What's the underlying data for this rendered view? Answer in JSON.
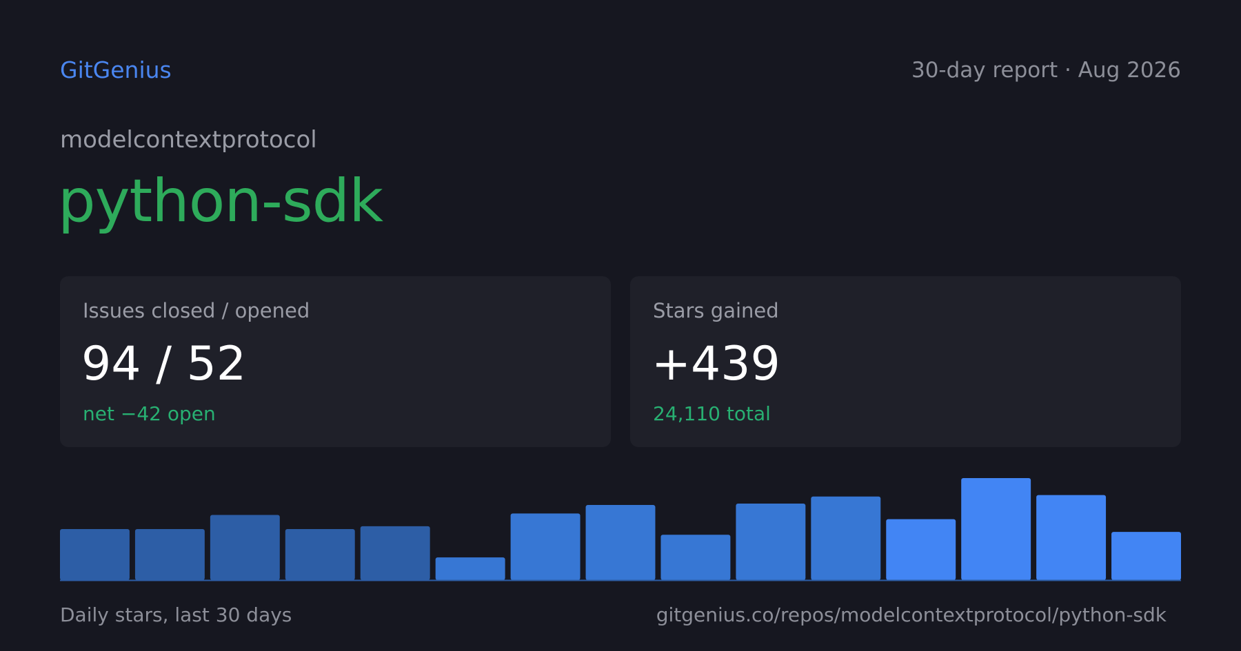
{
  "header": {
    "brand": "GitGenius",
    "report_meta": "30-day report · Aug 2026"
  },
  "repo": {
    "owner": "modelcontextprotocol",
    "name": "python-sdk"
  },
  "cards": {
    "issues": {
      "label": "Issues closed / opened",
      "value": "94 / 52",
      "sub": "net −42 open"
    },
    "stars": {
      "label": "Stars gained",
      "value": "+439",
      "sub": "24,110  total"
    }
  },
  "footer": {
    "caption": "Daily stars, last 30 days",
    "url": "gitgenius.co/repos/modelcontextprotocol/python-sdk"
  },
  "colors": {
    "background": "#161720",
    "card": "#1f2029",
    "brand": "#4a86f0",
    "repo_name": "#2eab5b",
    "positive": "#28b072",
    "bar_dark": "#2d5ea6",
    "bar_mid": "#3777d4",
    "bar_bright": "#4285f4"
  },
  "chart_data": {
    "type": "bar",
    "title": "",
    "xlabel": "",
    "ylabel": "",
    "values": [
      18,
      18,
      23,
      18,
      19,
      8,
      23.5,
      26.5,
      16,
      27,
      29.5,
      21.5,
      36,
      30,
      17
    ],
    "ylim": [
      0,
      36
    ],
    "grid": false,
    "legend": "none"
  }
}
